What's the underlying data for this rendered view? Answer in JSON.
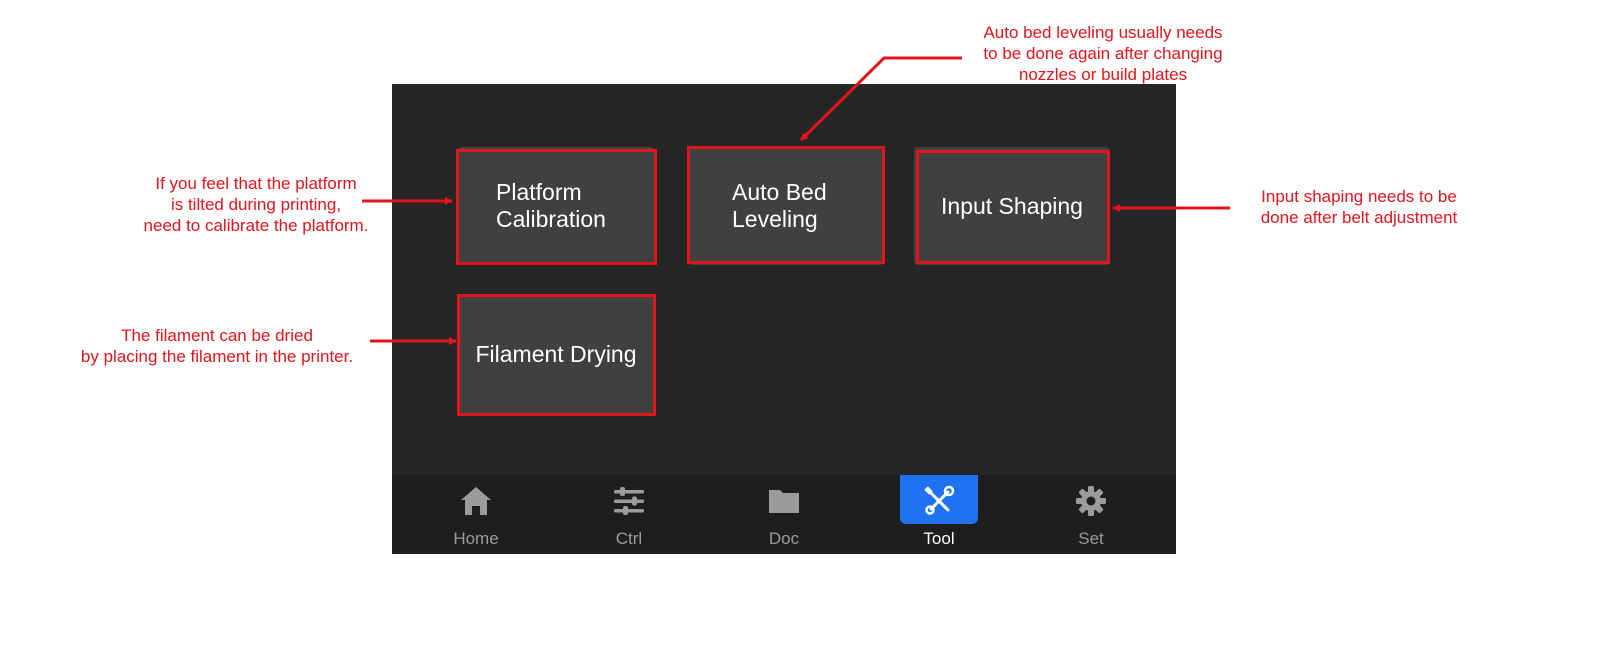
{
  "tools": {
    "platform_calibration": [
      "Platform",
      "Calibration"
    ],
    "auto_bed_leveling": [
      "Auto Bed",
      "Leveling"
    ],
    "input_shaping": "Input Shaping",
    "filament_drying": "Filament Drying"
  },
  "nav": {
    "home": "Home",
    "ctrl": "Ctrl",
    "doc": "Doc",
    "tool": "Tool",
    "set": "Set",
    "active": "tool"
  },
  "annotations": {
    "platform": [
      "If you feel that the platform",
      "is tilted during printing,",
      "need to calibrate the platform."
    ],
    "filament": [
      "The filament can be dried",
      "by placing the filament in the printer."
    ],
    "bed": [
      "Auto bed leveling usually needs",
      "to be done again after changing",
      "nozzles or build plates"
    ],
    "shaping": [
      "Input shaping needs to be",
      "done after belt adjustment"
    ]
  },
  "colors": {
    "background": "#262626",
    "tile": "#404040",
    "accent": "#1f73f0",
    "annotation": "#e3141c"
  },
  "icons": {
    "home": "home-icon",
    "ctrl": "sliders-icon",
    "doc": "folder-icon",
    "tool": "tools-icon",
    "set": "gear-icon"
  }
}
